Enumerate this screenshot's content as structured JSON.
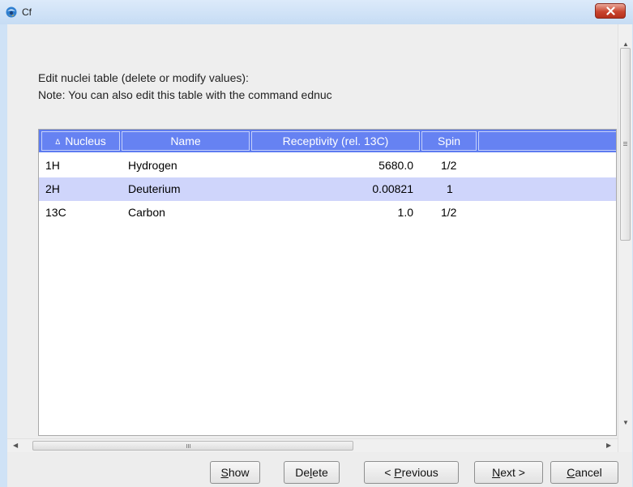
{
  "window": {
    "title": "Cf"
  },
  "instructions": {
    "line1": "Edit nuclei table (delete or modify values):",
    "line2": "Note: You can also edit this table with the command ednuc"
  },
  "table": {
    "sort_indicator": "Δ",
    "columns": [
      "Nucleus",
      "Name",
      "Receptivity (rel. 13C)",
      "Spin",
      ""
    ],
    "rows": [
      {
        "nucleus": "1H",
        "name": "Hydrogen",
        "receptivity": "5680.0",
        "spin": "1/2",
        "selected": false
      },
      {
        "nucleus": "2H",
        "name": "Deuterium",
        "receptivity": "0.00821",
        "spin": "1",
        "selected": true
      },
      {
        "nucleus": "13C",
        "name": "Carbon",
        "receptivity": "1.0",
        "spin": "1/2",
        "selected": false
      }
    ]
  },
  "buttons": {
    "show": {
      "pre": "",
      "key": "S",
      "post": "how"
    },
    "delete": {
      "pre": "De",
      "key": "l",
      "post": "ete"
    },
    "previous": {
      "pre": "< ",
      "key": "P",
      "post": "revious"
    },
    "next": {
      "pre": "",
      "key": "N",
      "post": "ext >"
    },
    "cancel": {
      "pre": "",
      "key": "C",
      "post": "ancel"
    }
  },
  "icons": {
    "app": "app-icon",
    "close": "close-icon",
    "scroll_up": "arrow-up-icon",
    "scroll_down": "arrow-down-icon",
    "scroll_left": "arrow-left-icon",
    "scroll_right": "arrow-right-icon"
  },
  "colors": {
    "header_bg": "#5e7cf0",
    "selected_row": "#cfd5fb",
    "close_button": "#c9452f"
  }
}
